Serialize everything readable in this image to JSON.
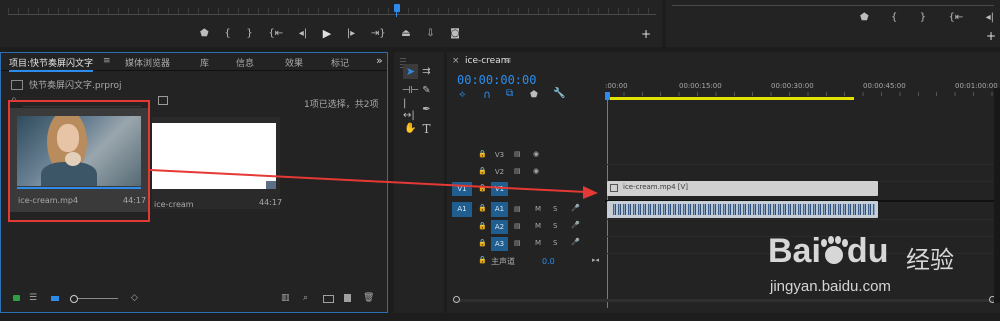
{
  "colors": {
    "accent": "#2d8ceb",
    "playhead": "#2d8ceb",
    "annotation": "#e53935",
    "work_area": "#e3e100",
    "selected_track": "#1f5e8f",
    "clip": "#d0d0d0"
  },
  "program_monitor": {
    "controls": [
      "marker-icon",
      "mark-in-icon",
      "mark-out-icon",
      "go-to-in-icon",
      "step-back-icon",
      "play-icon",
      "step-forward-icon",
      "go-to-out-icon",
      "lift-icon",
      "extract-icon",
      "export-frame-icon",
      "add-icon"
    ]
  },
  "source_monitor": {
    "controls": [
      "marker-icon",
      "mark-in-icon",
      "mark-out-icon",
      "go-to-in-icon",
      "add-icon"
    ]
  },
  "project_panel": {
    "tabs": [
      {
        "label": "项目:快节奏屏闪文字"
      },
      {
        "label": "媒体浏览器"
      },
      {
        "label": "库"
      },
      {
        "label": "信息"
      },
      {
        "label": "效果"
      },
      {
        "label": "标记"
      }
    ],
    "menu_glyph": "≡",
    "overflow_glyph": "»",
    "project_file": "快节奏屏闪文字.prproj",
    "selection_info": "1项已选择，共2项",
    "items": [
      {
        "name": "ice-cream.mp4",
        "duration": "44:17"
      },
      {
        "name": "ice-cream",
        "duration": "44:17"
      }
    ]
  },
  "timeline": {
    "tab_label": "ice-cream",
    "close_glyph": "×",
    "menu_glyph": "≡",
    "timecode": "00:00:00:00",
    "ruler_labels": [
      ":00:00",
      "00:00:15:00",
      "00:00:30:00",
      "00:00:45:00",
      "00:01:00:00"
    ],
    "video_tracks": [
      {
        "label": "V3",
        "source": ""
      },
      {
        "label": "V2",
        "source": ""
      },
      {
        "label": "V1",
        "source": "V1"
      }
    ],
    "audio_tracks": [
      {
        "label": "A1",
        "source": "A1"
      },
      {
        "label": "A2",
        "source": ""
      },
      {
        "label": "A3",
        "source": ""
      }
    ],
    "mute_label": "M",
    "solo_label": "S",
    "master_label": "主声道",
    "master_value": "0.0",
    "clip_label": "ice-cream.mp4 [V]"
  },
  "watermark": {
    "brand": "Bai",
    "brand2": "du",
    "suffix": "经验",
    "url": "jingyan.baidu.com"
  }
}
